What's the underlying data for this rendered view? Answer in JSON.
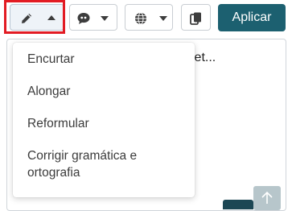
{
  "toolbar": {
    "apply_label": "Aplicar",
    "icons": {
      "pencil": "pencil-icon",
      "caret_up": "caret-up-icon",
      "chat": "chat-quote-icon",
      "globe": "globe-icon",
      "copy": "copy-icon"
    }
  },
  "editor": {
    "visible_text": "jet..."
  },
  "menu": {
    "items": [
      {
        "label": "Encurtar"
      },
      {
        "label": "Alongar"
      },
      {
        "label": "Reformular"
      },
      {
        "label": "Corrigir gramática e ortografia"
      }
    ]
  },
  "colors": {
    "accent": "#1c6070",
    "highlight": "#e21b23",
    "scroll_button": "#b7c6cb"
  }
}
